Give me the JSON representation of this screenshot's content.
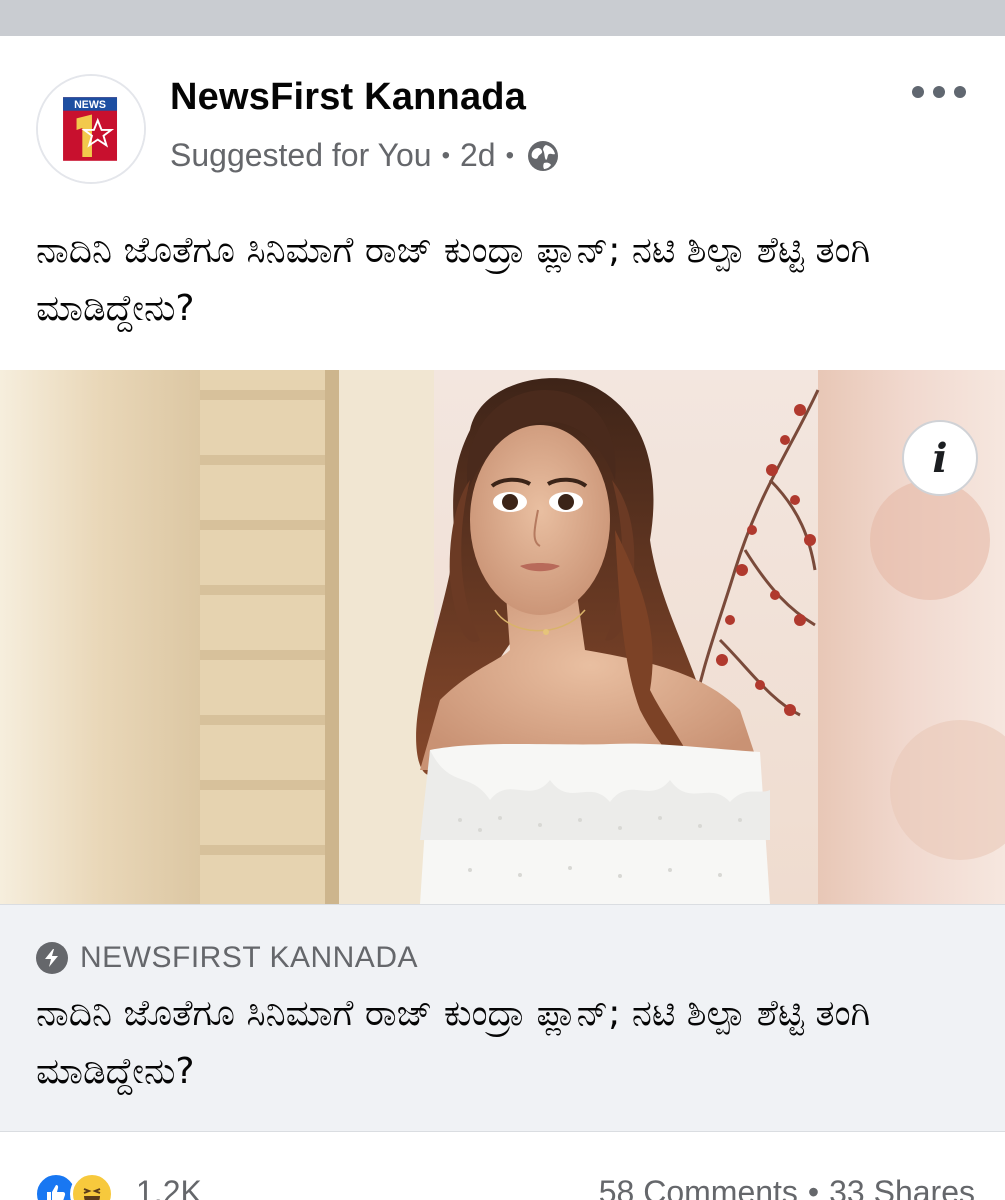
{
  "post": {
    "page_name": "NewsFirst Kannada",
    "suggested_label": "Suggested for You",
    "separator": "•",
    "time_ago": "2d",
    "privacy_icon": "globe-icon",
    "avatar_logo_text": "NEWS",
    "text": "ನಾದಿನಿ ಜೊತೆಗೂ ಸಿನಿಮಾಗೆ ರಾಜ್ ಕುಂದ್ರಾ ಪ್ಲಾನ್; ನಟಿ ಶಿಲ್ಪಾ ಶೆಟ್ಟಿ ತಂಗಿ ಮಾಡಿದ್ದೇನು?",
    "info_button_label": "i"
  },
  "link": {
    "source_icon": "bolt-icon",
    "source": "NEWSFIRST KANNADA",
    "title": "ನಾದಿನಿ ಜೊತೆಗೂ ಸಿನಿಮಾಗೆ ರಾಜ್ ಕುಂದ್ರಾ ಪ್ಲಾನ್; ನಟಿ ಶಿಲ್ಪಾ ಶೆಟ್ಟಿ ತಂಗಿ ಮಾಡಿದ್ದೇನು?"
  },
  "stats": {
    "reactions": "1.2K",
    "comments": "58 Comments",
    "separator": "•",
    "shares": "33 Shares"
  },
  "colors": {
    "brand_blue": "#1877f2",
    "secondary_text": "#65676b",
    "top_strip": "#c9ccd1",
    "preview_bg": "#f0f2f5"
  }
}
